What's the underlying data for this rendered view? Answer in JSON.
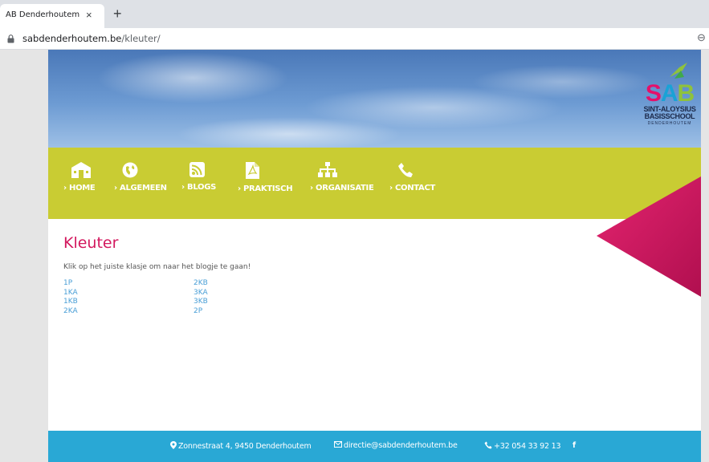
{
  "browser": {
    "tab_title": "AB Denderhoutem",
    "tab_close": "×",
    "new_tab": "+",
    "url_host": "sabdenderhoutem.be",
    "url_path": "/kleuter/",
    "zoom_glyph": "⊖"
  },
  "logo": {
    "letters": [
      "S",
      "A",
      "B"
    ],
    "line1": "SINT-ALOYSIUS",
    "line2": "BASISSCHOOL",
    "line3": "DENDERHOUTEM"
  },
  "nav": {
    "items": [
      {
        "label": "› HOME",
        "icon": "school-icon"
      },
      {
        "label": "› ALGEMEEN",
        "icon": "globe-icon"
      },
      {
        "label": "› BLOGS",
        "icon": "rss-icon"
      },
      {
        "label": "› PRAKTISCH",
        "icon": "pdf-icon"
      },
      {
        "label": "› ORGANISATIE",
        "icon": "sitemap-icon"
      },
      {
        "label": "› CONTACT",
        "icon": "phone-icon"
      }
    ]
  },
  "content": {
    "title": "Kleuter",
    "intro": "Klik op het juiste klasje om naar het blogje te gaan!",
    "links_col1": [
      "1P",
      "1KA",
      "1KB",
      "2KA"
    ],
    "links_col2": [
      "2KB",
      "3KA",
      "3KB",
      "2P"
    ]
  },
  "footer": {
    "address": "Zonnestraat 4, 9450 Denderhoutem",
    "email": "directie@sabdenderhoutem.be",
    "phone": "+32 054 33 92 13",
    "facebook": "f"
  },
  "colors": {
    "nav_bg": "#c9cc33",
    "title": "#d3185e",
    "link": "#4a9fd6",
    "footer_bg": "#29a8d5",
    "triangle": "#d3185e"
  }
}
